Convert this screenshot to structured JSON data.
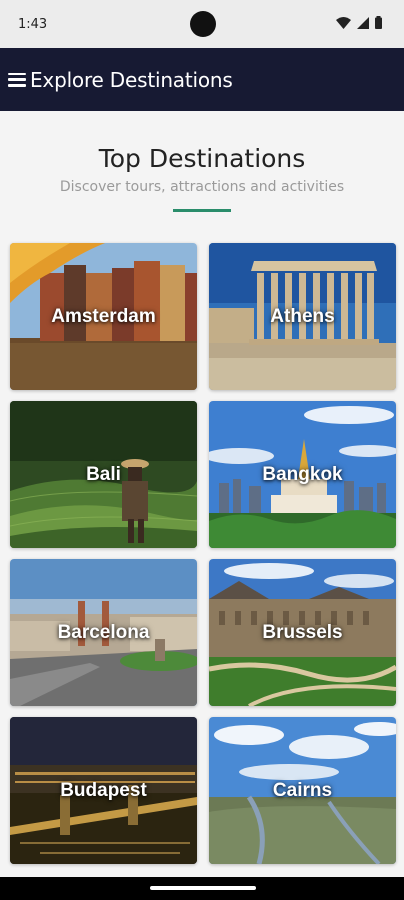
{
  "status": {
    "time": "1:43",
    "icons": [
      "wifi-icon",
      "signal-icon",
      "battery-icon"
    ]
  },
  "app_bar": {
    "title": "Explore Destinations",
    "menu_icon": "hamburger-menu-icon",
    "background": "#171a33"
  },
  "section": {
    "title": "Top Destinations",
    "subtitle": "Discover tours, attractions and activities",
    "accent_color": "#2a8d6b"
  },
  "destinations": [
    {
      "name": "Amsterdam"
    },
    {
      "name": "Athens"
    },
    {
      "name": "Bali"
    },
    {
      "name": "Bangkok"
    },
    {
      "name": "Barcelona"
    },
    {
      "name": "Brussels"
    },
    {
      "name": "Budapest"
    },
    {
      "name": "Cairns"
    }
  ]
}
